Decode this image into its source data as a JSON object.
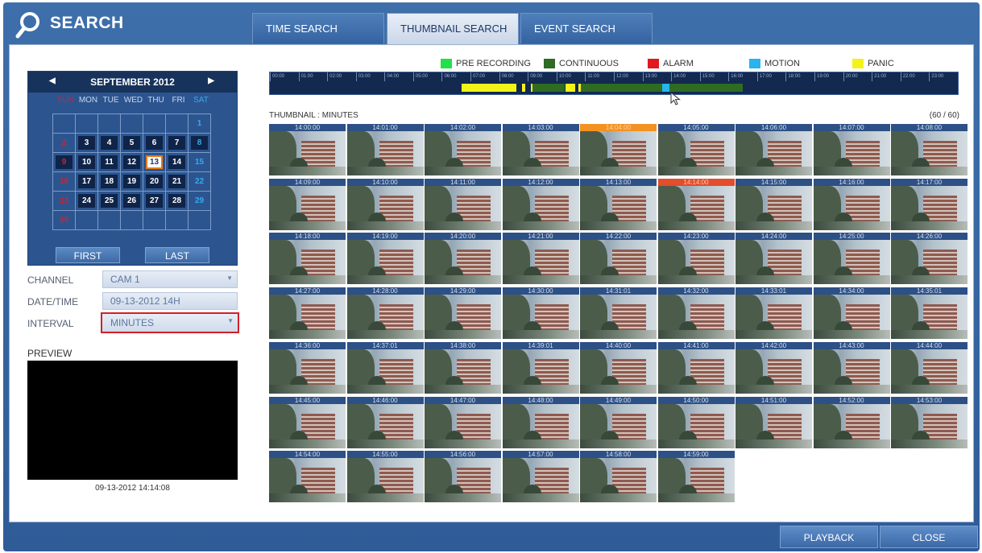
{
  "header": {
    "title": "SEARCH",
    "logo_icon": "magnifier-icon"
  },
  "tabs": [
    {
      "label": "TIME SEARCH"
    },
    {
      "label": "THUMBNAIL SEARCH",
      "active": true
    },
    {
      "label": "EVENT SEARCH"
    }
  ],
  "calendar": {
    "title": "SEPTEMBER 2012",
    "prev_icon": "triangle-left-icon",
    "next_icon": "triangle-right-icon",
    "weekdays": [
      "SUN",
      "MON",
      "TUE",
      "WED",
      "THU",
      "FRI",
      "SAT"
    ],
    "days": [
      "",
      "",
      "",
      "",
      "",
      "",
      "1",
      "2",
      "3",
      "4",
      "5",
      "6",
      "7",
      "8",
      "9",
      "10",
      "11",
      "12",
      "13",
      "14",
      "15",
      "16",
      "17",
      "18",
      "19",
      "20",
      "21",
      "22",
      "23",
      "24",
      "25",
      "26",
      "27",
      "28",
      "29",
      "30",
      "",
      "",
      "",
      "",
      "",
      ""
    ],
    "recorded_days": [
      "3",
      "4",
      "5",
      "6",
      "7",
      "8",
      "9",
      "10",
      "11",
      "12",
      "13",
      "14",
      "17",
      "18",
      "19",
      "20",
      "21",
      "24",
      "25",
      "26",
      "27",
      "28"
    ],
    "selected_day": "13",
    "first_label": "FIRST",
    "last_label": "LAST"
  },
  "fields": {
    "channel_label": "CHANNEL",
    "channel_value": "CAM 1",
    "datetime_label": "DATE/TIME",
    "datetime_value": "09-13-2012  14H",
    "interval_label": "INTERVAL",
    "interval_value": "MINUTES"
  },
  "preview": {
    "label": "PREVIEW",
    "timestamp": "09-13-2012  14:14:08"
  },
  "legend": [
    {
      "label": "PRE RECORDING",
      "color": "#22e04a"
    },
    {
      "label": "CONTINUOUS",
      "color": "#2f6b22"
    },
    {
      "label": "ALARM",
      "color": "#e0181f"
    },
    {
      "label": "MOTION",
      "color": "#27b4ef"
    },
    {
      "label": "PANIC",
      "color": "#f3f31a"
    }
  ],
  "timeline": {
    "hours": [
      "00:00",
      "01:00",
      "02:00",
      "03:00",
      "04:00",
      "05:00",
      "06:00",
      "07:00",
      "08:00",
      "09:00",
      "10:00",
      "11:00",
      "12:00",
      "13:00",
      "14:00",
      "15:00",
      "16:00",
      "17:00",
      "18:00",
      "19:00",
      "20:00",
      "21:00",
      "22:00",
      "23:00"
    ],
    "segments": [
      {
        "type": "panic",
        "start_hour": 6.7,
        "end_hour": 8.6,
        "color": "#f3f31a"
      },
      {
        "type": "panic",
        "start_hour": 8.8,
        "end_hour": 8.9,
        "color": "#f3f31a"
      },
      {
        "type": "panic",
        "start_hour": 9.1,
        "end_hour": 9.15,
        "color": "#f3f31a"
      },
      {
        "type": "continuous",
        "start_hour": 9.15,
        "end_hour": 10.3,
        "color": "#2f6b22"
      },
      {
        "type": "panic",
        "start_hour": 10.3,
        "end_hour": 10.65,
        "color": "#f3f31a"
      },
      {
        "type": "panic",
        "start_hour": 10.75,
        "end_hour": 10.85,
        "color": "#f3f31a"
      },
      {
        "type": "continuous",
        "start_hour": 10.85,
        "end_hour": 13.7,
        "color": "#2f6b22"
      },
      {
        "type": "motion",
        "start_hour": 13.7,
        "end_hour": 13.95,
        "color": "#27b4ef"
      },
      {
        "type": "continuous",
        "start_hour": 13.95,
        "end_hour": 16.5,
        "color": "#2f6b22"
      }
    ],
    "cursor_icon": "mouse-pointer-icon"
  },
  "thumbnails": {
    "label": "THUMBNAIL : MINUTES",
    "count": "(60 / 60)",
    "items": [
      {
        "time": "14:00:00"
      },
      {
        "time": "14:01:00"
      },
      {
        "time": "14:02:00"
      },
      {
        "time": "14:03:00"
      },
      {
        "time": "14:04:00",
        "event": "motion"
      },
      {
        "time": "14:05:00"
      },
      {
        "time": "14:06:00"
      },
      {
        "time": "14:07:00"
      },
      {
        "time": "14:08:00"
      },
      {
        "time": "14:09:00"
      },
      {
        "time": "14:10:00"
      },
      {
        "time": "14:11:00"
      },
      {
        "time": "14:12:00"
      },
      {
        "time": "14:13:00"
      },
      {
        "time": "14:14:00",
        "event": "alarm"
      },
      {
        "time": "14:15:00"
      },
      {
        "time": "14:16:00"
      },
      {
        "time": "14:17:00"
      },
      {
        "time": "14:18:00"
      },
      {
        "time": "14:19:00"
      },
      {
        "time": "14:20:00"
      },
      {
        "time": "14:21:00"
      },
      {
        "time": "14:22:00"
      },
      {
        "time": "14:23:00"
      },
      {
        "time": "14:24:00"
      },
      {
        "time": "14:25:00"
      },
      {
        "time": "14:26:00"
      },
      {
        "time": "14:27:00"
      },
      {
        "time": "14:28:00"
      },
      {
        "time": "14:29:00"
      },
      {
        "time": "14:30:00"
      },
      {
        "time": "14:31:01"
      },
      {
        "time": "14:32:00"
      },
      {
        "time": "14:33:01"
      },
      {
        "time": "14:34:00"
      },
      {
        "time": "14:35:01"
      },
      {
        "time": "14:36:00"
      },
      {
        "time": "14:37:01"
      },
      {
        "time": "14:38:00"
      },
      {
        "time": "14:39:01"
      },
      {
        "time": "14:40:00"
      },
      {
        "time": "14:41:00"
      },
      {
        "time": "14:42:00"
      },
      {
        "time": "14:43:00"
      },
      {
        "time": "14:44:00"
      },
      {
        "time": "14:45:00"
      },
      {
        "time": "14:46:00"
      },
      {
        "time": "14:47:00"
      },
      {
        "time": "14:48:00"
      },
      {
        "time": "14:49:00"
      },
      {
        "time": "14:50:00"
      },
      {
        "time": "14:51:00"
      },
      {
        "time": "14:52:00"
      },
      {
        "time": "14:53:00"
      },
      {
        "time": "14:54:00"
      },
      {
        "time": "14:55:00"
      },
      {
        "time": "14:56:00"
      },
      {
        "time": "14:57:00"
      },
      {
        "time": "14:58:00"
      },
      {
        "time": "14:59:00"
      }
    ]
  },
  "footer": {
    "playback_label": "PLAYBACK",
    "close_label": "CLOSE"
  }
}
